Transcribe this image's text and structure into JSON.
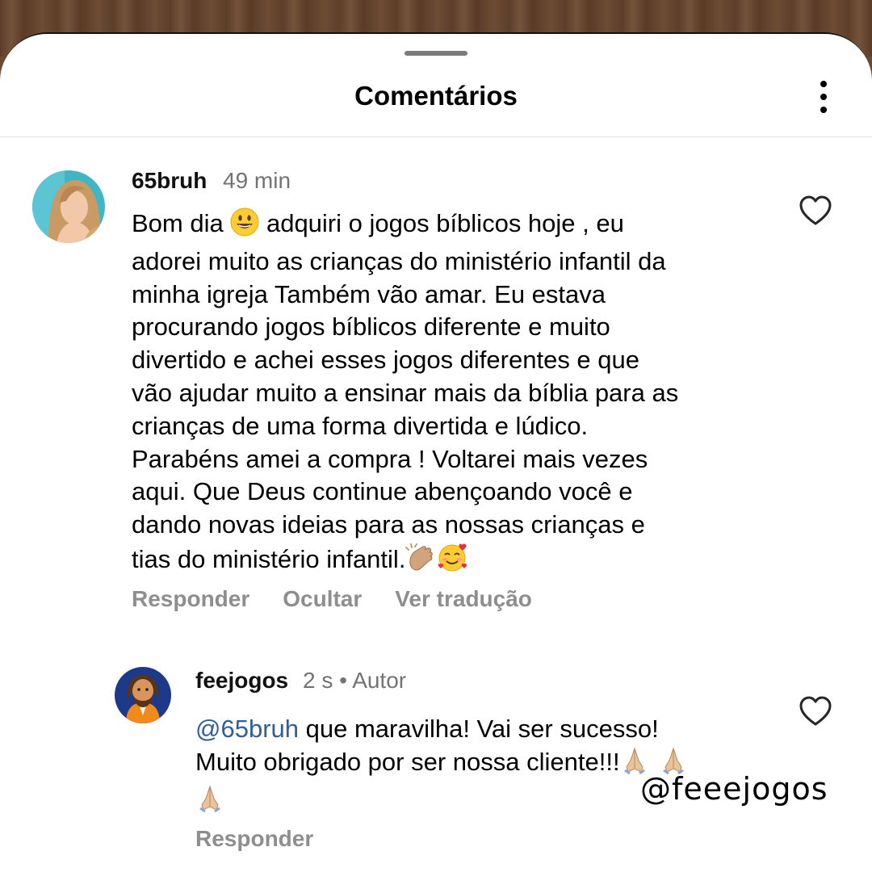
{
  "header": {
    "title": "Comentários"
  },
  "comments": [
    {
      "username": "65bruh",
      "time": "49 min",
      "text_before_emoji": "Bom dia ",
      "text_after_emoji": " adquiri o jogos bíblicos hoje , eu\nadorei muito as crianças do ministério infantil da\nminha igreja Também vão amar. Eu estava\nprocurando jogos bíblicos diferente e muito\ndivertido e achei esses jogos diferentes e que\nvão ajudar muito a ensinar mais da bíblia para as\ncrianças de uma forma divertida e lúdico.\nParabéns amei a compra ! Voltarei mais vezes\naqui. Que Deus continue abençoando você e\ndando novas ideias para as nossas crianças e\ntias do ministério infantil.",
      "actions": {
        "reply": "Responder",
        "hide": "Ocultar",
        "translate": "Ver tradução"
      }
    },
    {
      "username": "feejogos",
      "time": "2 s",
      "separator": "•",
      "author_label": "Autor",
      "mention": "@65bruh",
      "text": " que maravilha! Vai ser sucesso!\nMuito obrigado por ser nossa cliente!!!",
      "actions": {
        "reply": "Responder"
      }
    }
  ],
  "watermark": "@feeejogos",
  "icons": {
    "like": "heart-icon",
    "menu": "kebab-menu-icon"
  },
  "colors": {
    "mention": "#2e5e9c",
    "secondary_text": "#737373",
    "action_text": "#8e8e8e"
  }
}
